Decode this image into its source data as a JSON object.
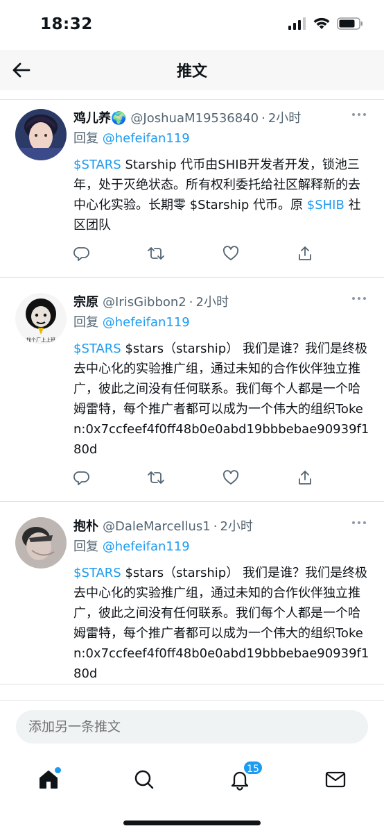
{
  "status": {
    "time": "18:32"
  },
  "nav": {
    "title": "推文"
  },
  "tweets": [
    {
      "name": "鸡儿养",
      "name_emoji": "🌍",
      "handle": "@JoshuaM19536840",
      "time": "2小时",
      "reply_prefix": "回复",
      "reply_to": "@hefeifan119",
      "cashtag": "$STARS",
      "body_1": " Starship 代币由SHIB开发者开发，锁池三年，处于灭绝状态。所有权利委托给社区解释新的去中心化实验。长期零 $Starship 代币。原 ",
      "cashtag_2": "$SHIB",
      "body_2": " 社区团队"
    },
    {
      "name": "宗原",
      "handle": "@IrisGibbon2",
      "time": "2小时",
      "reply_prefix": "回复",
      "reply_to": "@hefeifan119",
      "cashtag": "$STARS",
      "body_1": " $stars（starship） 我们是谁？我们是终极去中心化的实验推广组，通过未知的合作伙伴独立推广，彼此之间没有任何联系。我们每个人都是一个哈姆雷特，每个推广者都可以成为一个伟大的组织Token:0x7ccfeef4f0ff48b0e0abd19bbbebae90939f180d",
      "avatar_text": "找个厂上上班"
    },
    {
      "name": "抱朴",
      "handle": "@DaleMarcellus1",
      "time": "2小时",
      "reply_prefix": "回复",
      "reply_to": "@hefeifan119",
      "cashtag": "$STARS",
      "body_1": " $stars（starship） 我们是谁？我们是终极去中心化的实验推广组，通过未知的合作伙伴独立推广，彼此之间没有任何联系。我们每个人都是一个哈姆雷特，每个推广者都可以成为一个伟大的组织Token:0x7ccfeef4f0ff48b0e0abd19bbbebae90939f180d"
    }
  ],
  "compose": {
    "placeholder": "添加另一条推文"
  },
  "tabs": {
    "notifications_badge": "15"
  },
  "colors": {
    "accent": "#1d9bf0",
    "text": "#0f1419",
    "muted": "#536471"
  },
  "icons": [
    "back-arrow-icon",
    "reply-icon",
    "retweet-icon",
    "like-icon",
    "share-icon",
    "home-icon",
    "search-icon",
    "bell-icon",
    "mail-icon"
  ]
}
